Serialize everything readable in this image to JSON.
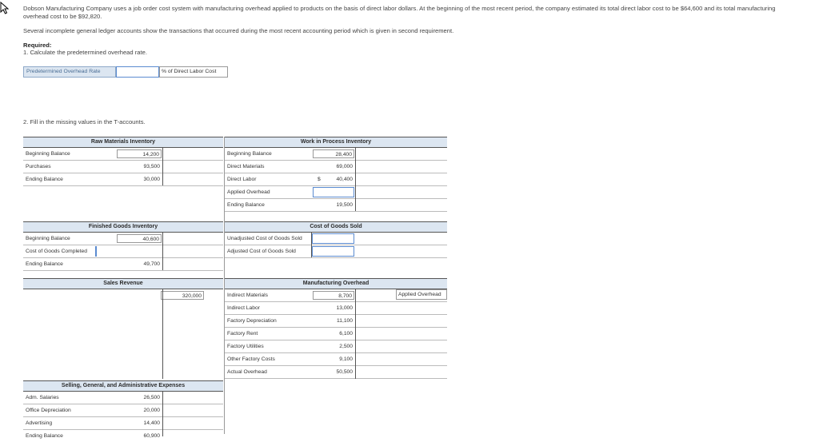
{
  "intro": {
    "line1": "Dobson Manufacturing Company uses a job order cost system with manufacturing overhead applied to products on the basis of direct labor dollars. At the beginning of the most recent period, the company estimated its total direct labor cost to be $64,600 and its total manufacturing",
    "line2": "overhead cost to be $92,820.",
    "line3": "Several incomplete general ledger accounts show the transactions that occurred during the most recent accounting period which is given in second requirement."
  },
  "required": {
    "heading": "Required:",
    "req1": "1. Calculate the predetermined overhead rate.",
    "rate_label": "Predetermined Overhead Rate",
    "rate_value": "",
    "rate_unit": "% of Direct Labor Cost",
    "req2": "2. Fill in the missing values in the T-accounts."
  },
  "accounts": {
    "raw_materials": {
      "title": "Raw Materials Inventory",
      "rows": [
        {
          "label": "Beginning Balance",
          "value": "14,200"
        },
        {
          "label": "Purchases",
          "value": "93,500"
        },
        {
          "label": "Ending Balance",
          "value": "30,000"
        }
      ]
    },
    "wip": {
      "title": "Work in Process Inventory",
      "rows": [
        {
          "label": "Beginning Balance",
          "value": "28,400"
        },
        {
          "label": "Direct Materials",
          "value": "69,000"
        },
        {
          "label": "Direct Labor",
          "prefix": "$",
          "value": "40,400"
        },
        {
          "label": "Applied Overhead",
          "value": ""
        },
        {
          "label": "Ending Balance",
          "value": "19,500"
        }
      ]
    },
    "finished_goods": {
      "title": "Finished Goods Inventory",
      "rows": [
        {
          "label": "Beginning Balance",
          "value": "40,600"
        },
        {
          "label": "Cost of Goods Completed",
          "value": ""
        },
        {
          "label": "Ending Balance",
          "value": "49,700"
        }
      ]
    },
    "cogs": {
      "title": "Cost of Goods Sold",
      "rows": [
        {
          "label": "Unadjusted Cost of Goods Sold",
          "value": ""
        },
        {
          "label": "Adjusted Cost of Goods Sold",
          "value": ""
        }
      ]
    },
    "sales": {
      "title": "Sales Revenue",
      "value": "320,000"
    },
    "mfg_overhead": {
      "title": "Manufacturing Overhead",
      "rows": [
        {
          "label": "Indirect Materials",
          "value": "8,700"
        },
        {
          "label": "Indirect Labor",
          "value": "13,000"
        },
        {
          "label": "Factory Depreciation",
          "value": "11,100"
        },
        {
          "label": "Factory Rent",
          "value": "6,100"
        },
        {
          "label": "Factory Utilities",
          "value": "2,500"
        },
        {
          "label": "Other Factory Costs",
          "value": "9,100"
        },
        {
          "label": "Actual Overhead",
          "value": "50,500"
        }
      ],
      "applied_label": "Applied Overhead"
    },
    "sga": {
      "title": "Selling, General, and Administrative Expenses",
      "rows": [
        {
          "label": "Adm. Salaries",
          "value": "26,500"
        },
        {
          "label": "Office Depreciation",
          "value": "20,000"
        },
        {
          "label": "Advertising",
          "value": "14,400"
        },
        {
          "label": "Ending Balance",
          "value": "60,900"
        }
      ]
    }
  }
}
